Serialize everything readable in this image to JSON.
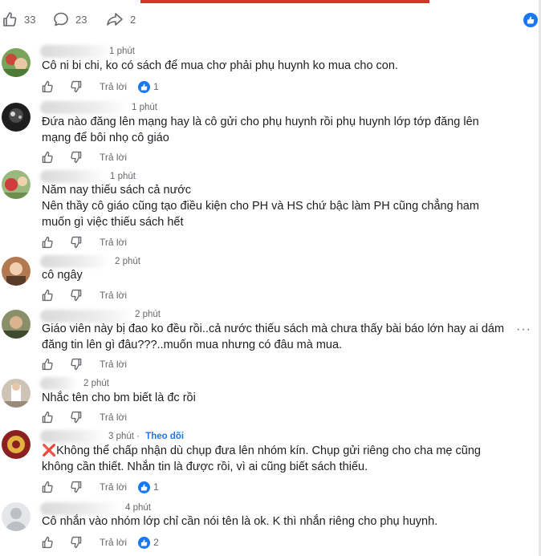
{
  "post_stats": {
    "likes": "33",
    "comments": "23",
    "shares": "2"
  },
  "labels": {
    "reply": "Trả lời",
    "follow": "Theo dõi"
  },
  "comments": [
    {
      "time": "1 phút",
      "lines": [
        "Cô ni bi chi, ko có sách để mua chơ phải phụ huynh ko mua cho con."
      ],
      "reactions": "1"
    },
    {
      "time": "1 phút",
      "lines": [
        "Đứa nào đăng lên mạng hay là cô gửi cho phụ huynh rồi phụ huynh lớp tớp đăng lên",
        "mạng để bôi nhọ cô giáo"
      ],
      "reactions": ""
    },
    {
      "time": "1 phút",
      "lines": [
        "Năm nay thiếu sách cả nước",
        "Nên thầy cô giáo cũng tạo điều kiện cho PH và HS chứ bậc làm PH cũng chẳng ham",
        "muốn gì việc thiếu sách hết"
      ],
      "reactions": ""
    },
    {
      "time": "2 phút",
      "lines": [
        "cô ngây"
      ],
      "reactions": ""
    },
    {
      "time": "2 phút",
      "lines": [
        "Giáo viên này bị đao ko đều rồi..cả nước thiếu sách mà chưa thấy bài báo lớn hay ai dám",
        "đăng tin lên gì đâu???..muốn mua nhưng có đâu mà mua."
      ],
      "reactions": ""
    },
    {
      "time": "2 phút",
      "lines": [
        "Nhắc tên cho bm biết là đc rồi"
      ],
      "reactions": ""
    },
    {
      "time": "3 phút",
      "lines": [
        "Không thể chấp nhận dù chụp đưa lên nhóm kín. Chụp gửi riêng cho cha mẹ cũng",
        "không cần thiết. Nhắn tin là được rồi, vì ai cũng biết sách thiếu."
      ],
      "reactions": "1",
      "prefix": "❌"
    },
    {
      "time": "4 phút",
      "lines": [
        "Cô nhắn vào nhóm lớp chỉ cần nói tên là ok. K thì nhắn riêng cho phụ huynh."
      ],
      "reactions": "2"
    }
  ],
  "colors": {
    "accent": "#1877f2",
    "meta": "#65676b",
    "text": "#1c1e21"
  }
}
